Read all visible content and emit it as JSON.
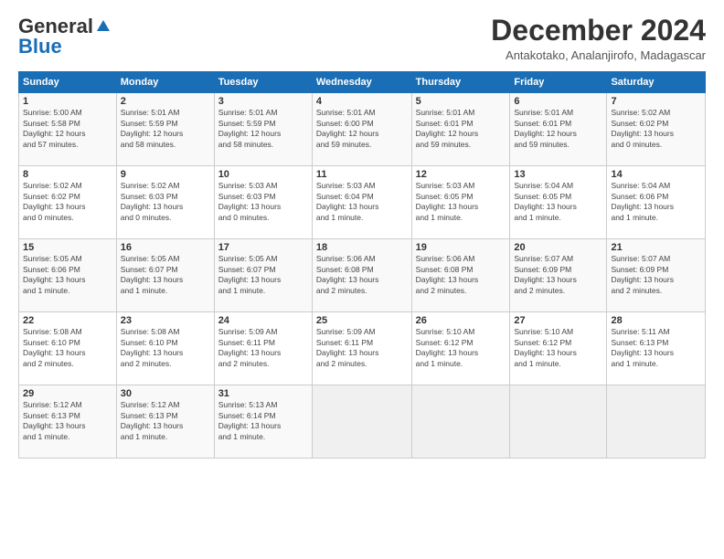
{
  "header": {
    "logo_line1": "General",
    "logo_line2": "Blue",
    "month_title": "December 2024",
    "subtitle": "Antakotako, Analanjirofo, Madagascar"
  },
  "days_of_week": [
    "Sunday",
    "Monday",
    "Tuesday",
    "Wednesday",
    "Thursday",
    "Friday",
    "Saturday"
  ],
  "weeks": [
    [
      {
        "day": "1",
        "info": "Sunrise: 5:00 AM\nSunset: 5:58 PM\nDaylight: 12 hours\nand 57 minutes."
      },
      {
        "day": "2",
        "info": "Sunrise: 5:01 AM\nSunset: 5:59 PM\nDaylight: 12 hours\nand 58 minutes."
      },
      {
        "day": "3",
        "info": "Sunrise: 5:01 AM\nSunset: 5:59 PM\nDaylight: 12 hours\nand 58 minutes."
      },
      {
        "day": "4",
        "info": "Sunrise: 5:01 AM\nSunset: 6:00 PM\nDaylight: 12 hours\nand 59 minutes."
      },
      {
        "day": "5",
        "info": "Sunrise: 5:01 AM\nSunset: 6:01 PM\nDaylight: 12 hours\nand 59 minutes."
      },
      {
        "day": "6",
        "info": "Sunrise: 5:01 AM\nSunset: 6:01 PM\nDaylight: 12 hours\nand 59 minutes."
      },
      {
        "day": "7",
        "info": "Sunrise: 5:02 AM\nSunset: 6:02 PM\nDaylight: 13 hours\nand 0 minutes."
      }
    ],
    [
      {
        "day": "8",
        "info": "Sunrise: 5:02 AM\nSunset: 6:02 PM\nDaylight: 13 hours\nand 0 minutes."
      },
      {
        "day": "9",
        "info": "Sunrise: 5:02 AM\nSunset: 6:03 PM\nDaylight: 13 hours\nand 0 minutes."
      },
      {
        "day": "10",
        "info": "Sunrise: 5:03 AM\nSunset: 6:03 PM\nDaylight: 13 hours\nand 0 minutes."
      },
      {
        "day": "11",
        "info": "Sunrise: 5:03 AM\nSunset: 6:04 PM\nDaylight: 13 hours\nand 1 minute."
      },
      {
        "day": "12",
        "info": "Sunrise: 5:03 AM\nSunset: 6:05 PM\nDaylight: 13 hours\nand 1 minute."
      },
      {
        "day": "13",
        "info": "Sunrise: 5:04 AM\nSunset: 6:05 PM\nDaylight: 13 hours\nand 1 minute."
      },
      {
        "day": "14",
        "info": "Sunrise: 5:04 AM\nSunset: 6:06 PM\nDaylight: 13 hours\nand 1 minute."
      }
    ],
    [
      {
        "day": "15",
        "info": "Sunrise: 5:05 AM\nSunset: 6:06 PM\nDaylight: 13 hours\nand 1 minute."
      },
      {
        "day": "16",
        "info": "Sunrise: 5:05 AM\nSunset: 6:07 PM\nDaylight: 13 hours\nand 1 minute."
      },
      {
        "day": "17",
        "info": "Sunrise: 5:05 AM\nSunset: 6:07 PM\nDaylight: 13 hours\nand 1 minute."
      },
      {
        "day": "18",
        "info": "Sunrise: 5:06 AM\nSunset: 6:08 PM\nDaylight: 13 hours\nand 2 minutes."
      },
      {
        "day": "19",
        "info": "Sunrise: 5:06 AM\nSunset: 6:08 PM\nDaylight: 13 hours\nand 2 minutes."
      },
      {
        "day": "20",
        "info": "Sunrise: 5:07 AM\nSunset: 6:09 PM\nDaylight: 13 hours\nand 2 minutes."
      },
      {
        "day": "21",
        "info": "Sunrise: 5:07 AM\nSunset: 6:09 PM\nDaylight: 13 hours\nand 2 minutes."
      }
    ],
    [
      {
        "day": "22",
        "info": "Sunrise: 5:08 AM\nSunset: 6:10 PM\nDaylight: 13 hours\nand 2 minutes."
      },
      {
        "day": "23",
        "info": "Sunrise: 5:08 AM\nSunset: 6:10 PM\nDaylight: 13 hours\nand 2 minutes."
      },
      {
        "day": "24",
        "info": "Sunrise: 5:09 AM\nSunset: 6:11 PM\nDaylight: 13 hours\nand 2 minutes."
      },
      {
        "day": "25",
        "info": "Sunrise: 5:09 AM\nSunset: 6:11 PM\nDaylight: 13 hours\nand 2 minutes."
      },
      {
        "day": "26",
        "info": "Sunrise: 5:10 AM\nSunset: 6:12 PM\nDaylight: 13 hours\nand 1 minute."
      },
      {
        "day": "27",
        "info": "Sunrise: 5:10 AM\nSunset: 6:12 PM\nDaylight: 13 hours\nand 1 minute."
      },
      {
        "day": "28",
        "info": "Sunrise: 5:11 AM\nSunset: 6:13 PM\nDaylight: 13 hours\nand 1 minute."
      }
    ],
    [
      {
        "day": "29",
        "info": "Sunrise: 5:12 AM\nSunset: 6:13 PM\nDaylight: 13 hours\nand 1 minute."
      },
      {
        "day": "30",
        "info": "Sunrise: 5:12 AM\nSunset: 6:13 PM\nDaylight: 13 hours\nand 1 minute."
      },
      {
        "day": "31",
        "info": "Sunrise: 5:13 AM\nSunset: 6:14 PM\nDaylight: 13 hours\nand 1 minute."
      },
      {
        "day": "",
        "info": ""
      },
      {
        "day": "",
        "info": ""
      },
      {
        "day": "",
        "info": ""
      },
      {
        "day": "",
        "info": ""
      }
    ]
  ]
}
